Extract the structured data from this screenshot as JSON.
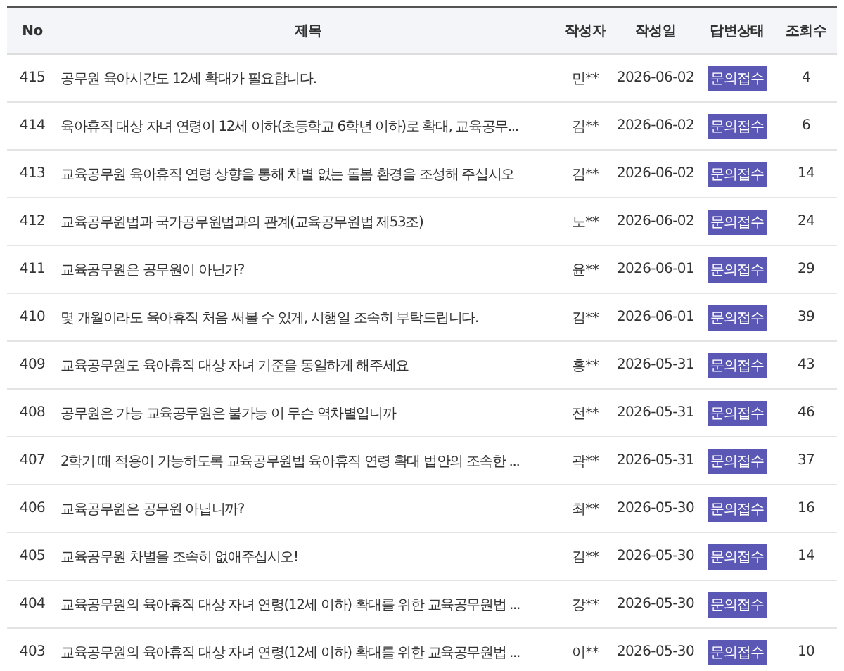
{
  "table": {
    "columns": [
      "No",
      "제목",
      "작성자",
      "작성일",
      "답변상태",
      "조회수"
    ],
    "rows": [
      {
        "no": "415",
        "title": "공무원 육아시간도 12세 확대가 필요합니다.",
        "author": "민**",
        "date": "2026-06-02",
        "status": "문의접수",
        "views": "4"
      },
      {
        "no": "414",
        "title": "육아휴직 대상 자녀 연령이 12세 이하(초등학교 6학년 이하)로 확대, 교육공무...",
        "author": "김**",
        "date": "2026-06-02",
        "status": "문의접수",
        "views": "6"
      },
      {
        "no": "413",
        "title": "교육공무원 육아휴직 연령 상향을 통해 차별 없는 돌봄 환경을 조성해 주십시오",
        "author": "김**",
        "date": "2026-06-02",
        "status": "문의접수",
        "views": "14"
      },
      {
        "no": "412",
        "title": "교육공무원법과 국가공무원법과의 관계(교육공무원법 제53조)",
        "author": "노**",
        "date": "2026-06-02",
        "status": "문의접수",
        "views": "24"
      },
      {
        "no": "411",
        "title": "교육공무원은 공무원이 아닌가?",
        "author": "윤**",
        "date": "2026-06-01",
        "status": "문의접수",
        "views": "29"
      },
      {
        "no": "410",
        "title": "몇 개월이라도 육아휴직 처음 써볼 수 있게, 시행일 조속히 부탁드립니다.",
        "author": "김**",
        "date": "2026-06-01",
        "status": "문의접수",
        "views": "39"
      },
      {
        "no": "409",
        "title": "교육공무원도 육아휴직 대상 자녀 기준을 동일하게 해주세요",
        "author": "홍**",
        "date": "2026-05-31",
        "status": "문의접수",
        "views": "43"
      },
      {
        "no": "408",
        "title": "공무원은 가능 교육공무원은 불가능 이 무슨 역차별입니까",
        "author": "전**",
        "date": "2026-05-31",
        "status": "문의접수",
        "views": "46"
      },
      {
        "no": "407",
        "title": "2학기 때 적용이 가능하도록 교육공무원법 육아휴직 연령 확대 법안의 조속한 ...",
        "author": "곽**",
        "date": "2026-05-31",
        "status": "문의접수",
        "views": "37"
      },
      {
        "no": "406",
        "title": "교육공무원은 공무원 아닙니까?",
        "author": "최**",
        "date": "2026-05-30",
        "status": "문의접수",
        "views": "16"
      },
      {
        "no": "405",
        "title": "교육공무원 차별을 조속히 없애주십시오!",
        "author": "김**",
        "date": "2026-05-30",
        "status": "문의접수",
        "views": "14"
      },
      {
        "no": "404",
        "title": "교육공무원의 육아휴직 대상 자녀 연령(12세 이하) 확대를 위한 교육공무원법 ...",
        "author": "강**",
        "date": "2026-05-30",
        "status": "문의접수"
      },
      {
        "no": "403",
        "title": "교육공무원의 육아휴직 대상 자녀 연령(12세 이하) 확대를 위한 교육공무원법 ...",
        "author": "이**",
        "date": "2026-05-30",
        "status": "문의접수",
        "views": "10"
      }
    ]
  }
}
